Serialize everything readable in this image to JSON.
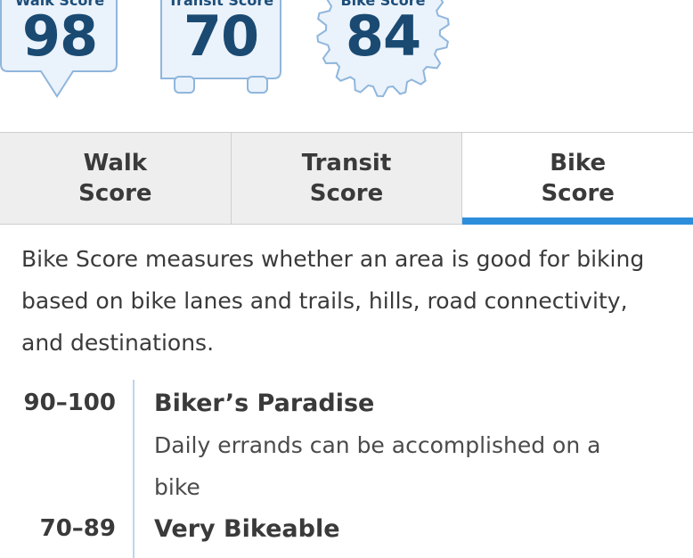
{
  "badges": [
    {
      "title": "Walk Score",
      "value": "98",
      "shape": "speech-bubble",
      "color": "#1a4a72",
      "fill": "#eaf2fb",
      "stroke": "#8fb6dc"
    },
    {
      "title": "Transit Score",
      "value": "70",
      "shape": "bus",
      "color": "#1a4a72",
      "fill": "#eaf2fb",
      "stroke": "#8fb6dc"
    },
    {
      "title": "Bike Score",
      "value": "84",
      "shape": "gear",
      "color": "#1a4a72",
      "fill": "#eaf2fb",
      "stroke": "#8fb6dc"
    }
  ],
  "tabs": [
    {
      "line1": "Walk",
      "line2": "Score",
      "active": false
    },
    {
      "line1": "Transit",
      "line2": "Score",
      "active": false
    },
    {
      "line1": "Bike",
      "line2": "Score",
      "active": true
    }
  ],
  "accent_color": "#2d8fdb",
  "description": "Bike Score measures whether an area is good for biking based on bike lanes and trails, hills, road connectivity, and destinations.",
  "ranges": [
    {
      "range": "90–100",
      "title": "Biker’s Paradise",
      "text": "Daily errands can be accomplished on a bike"
    },
    {
      "range": "70–89",
      "title": "Very Bikeable",
      "text": ""
    }
  ]
}
